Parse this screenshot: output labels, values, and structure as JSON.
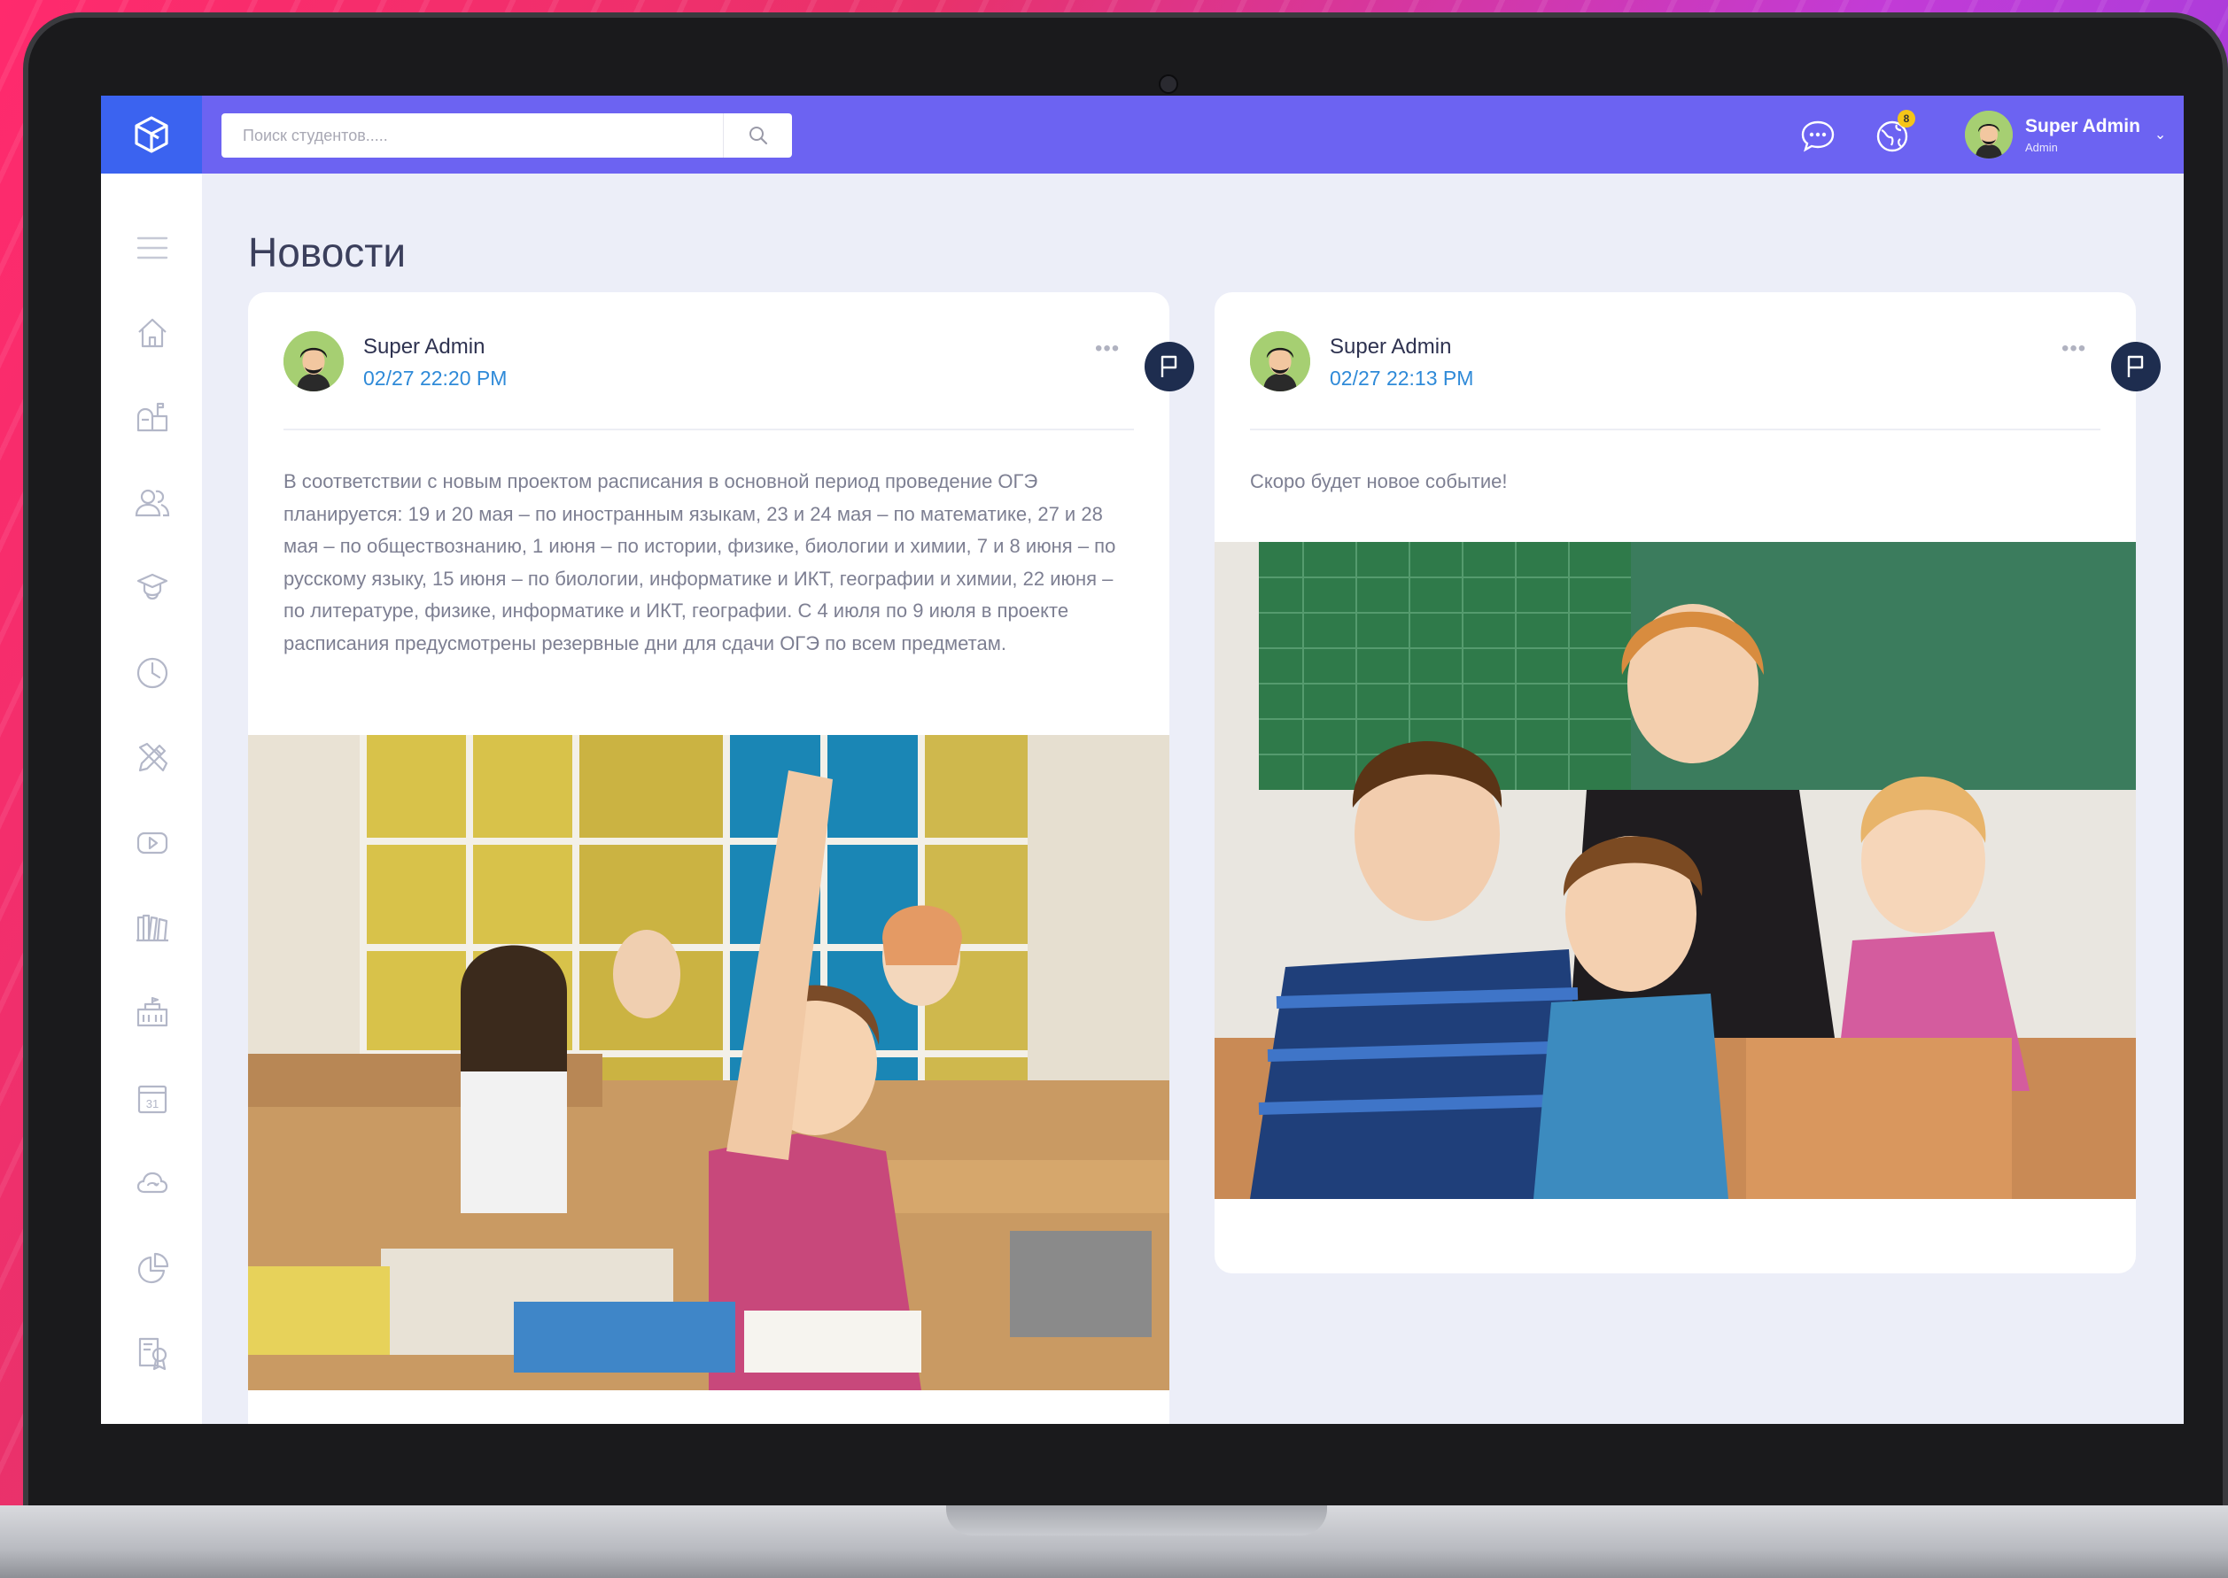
{
  "app": {
    "search_placeholder": "Поиск студентов.....",
    "notification_count": "8",
    "user": {
      "name": "Super Admin",
      "role": "Admin"
    }
  },
  "sidebar": {
    "items": [
      {
        "icon": "menu-icon"
      },
      {
        "icon": "home-icon"
      },
      {
        "icon": "mailbox-icon"
      },
      {
        "icon": "users-icon"
      },
      {
        "icon": "graduate-icon"
      },
      {
        "icon": "clock-icon"
      },
      {
        "icon": "tools-icon"
      },
      {
        "icon": "video-icon"
      },
      {
        "icon": "library-icon"
      },
      {
        "icon": "school-icon"
      },
      {
        "icon": "calendar-icon"
      },
      {
        "icon": "cloud-icon"
      },
      {
        "icon": "chart-icon"
      },
      {
        "icon": "certificate-icon"
      }
    ],
    "calendar_day": "31"
  },
  "page": {
    "title": "Новости"
  },
  "posts": [
    {
      "author": "Super Admin",
      "time": "02/27 22:20 PM",
      "text": "В соответствии с новым проектом расписания в основной период проведение ОГЭ планируется: 19 и 20 мая – по иностранным языкам, 23 и 24 мая – по математике, 27 и 28 мая – по обществознанию, 1 июня – по истории, физике, биологии и химии, 7 и 8 июня – по русскому языку, 15 июня – по биологии, информатике и ИКТ, географии и химии, 22 июня – по литературе, физике, информатике и ИКТ, географии. С 4 июля по 9 июля в проекте расписания предусмотрены резервные дни для сдачи ОГЭ по всем предметам.",
      "more": "•••"
    },
    {
      "author": "Super Admin",
      "time": "02/27 22:13 PM",
      "text": "Скоро будет новое событие!",
      "more": "•••"
    }
  ],
  "colors": {
    "topbar": "#6c63f2",
    "logo_bg": "#3b63f0",
    "link": "#2f8ad8",
    "flag_bg": "#1e2d4f"
  }
}
